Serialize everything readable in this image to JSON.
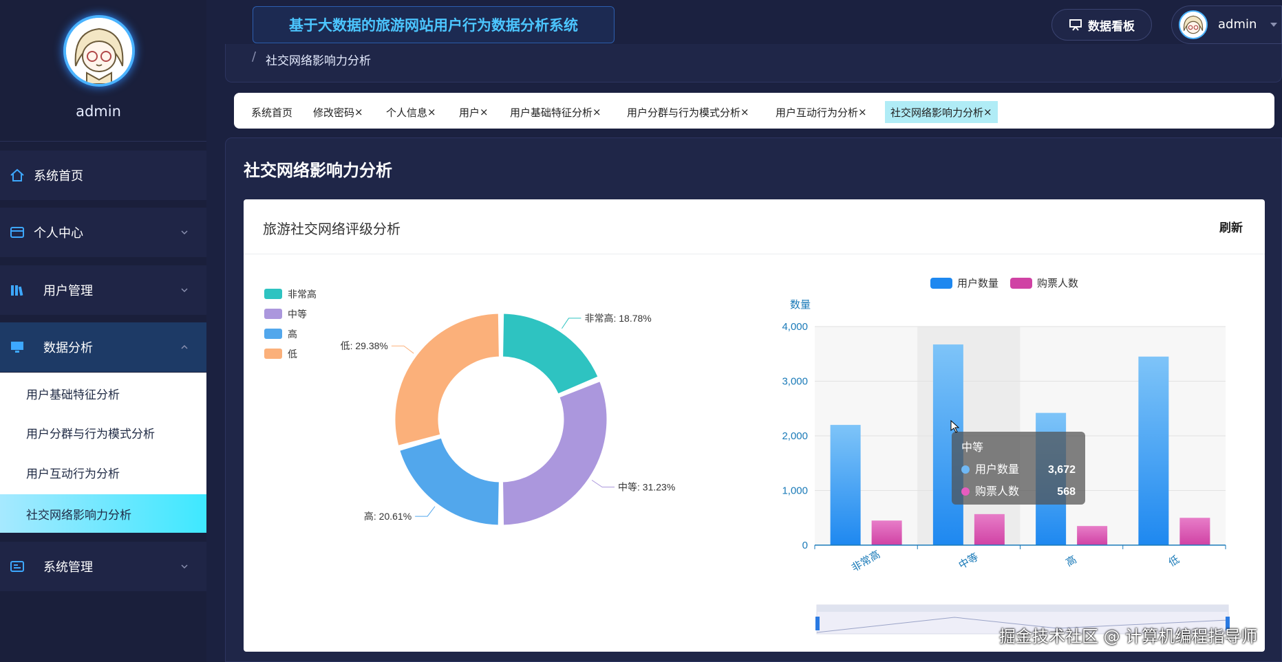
{
  "sidebar": {
    "username": "admin",
    "menu": [
      {
        "label": "系统首页"
      },
      {
        "label": "个人中心"
      },
      {
        "label": "用户管理"
      },
      {
        "label": "数据分析"
      },
      {
        "label": "系统管理"
      }
    ],
    "submenu": [
      {
        "label": "用户基础特征分析"
      },
      {
        "label": "用户分群与行为模式分析"
      },
      {
        "label": "用户互动行为分析"
      },
      {
        "label": "社交网络影响力分析"
      }
    ]
  },
  "header": {
    "title": "基于大数据的旅游网站用户行为数据分析系统",
    "dashboard_label": "数据看板",
    "username": "admin"
  },
  "breadcrumb": {
    "separator": "/",
    "current": "社交网络影响力分析"
  },
  "tabs": [
    {
      "label": "系统首页"
    },
    {
      "label": "修改密码",
      "close": "×"
    },
    {
      "label": "个人信息",
      "close": "×"
    },
    {
      "label": "用户",
      "close": "×"
    },
    {
      "label": "用户基础特征分析",
      "close": "×"
    },
    {
      "label": "用户分群与行为模式分析",
      "close": "×"
    },
    {
      "label": "用户互动行为分析",
      "close": "×"
    },
    {
      "label": "社交网络影响力分析",
      "close": "×"
    }
  ],
  "page": {
    "title": "社交网络影响力分析"
  },
  "card": {
    "title": "旅游社交网络评级分析",
    "refresh_label": "刷新"
  },
  "chart_data": [
    {
      "type": "pie",
      "variant": "donut",
      "legend": [
        "非常高",
        "中等",
        "高",
        "低"
      ],
      "legend_placement": "top-left",
      "slices": [
        {
          "label": "非常高",
          "value": 18.78,
          "display": "非常高: 18.78%",
          "color": "#2ec3c1"
        },
        {
          "label": "中等",
          "value": 31.23,
          "display": "中等: 31.23%",
          "color": "#ab97dd"
        },
        {
          "label": "高",
          "value": 20.61,
          "display": "高: 20.61%",
          "color": "#52a7ec"
        },
        {
          "label": "低",
          "value": 29.38,
          "display": "低: 29.38%",
          "color": "#fbb07a"
        }
      ]
    },
    {
      "type": "bar",
      "categories": [
        "非常高",
        "中等",
        "高",
        "低"
      ],
      "series": [
        {
          "name": "用户数量",
          "values": [
            2200,
            3672,
            2420,
            3450
          ],
          "color": "#1e88f0"
        },
        {
          "name": "购票人数",
          "values": [
            450,
            568,
            350,
            500
          ],
          "color": "#d042a4"
        }
      ],
      "ylabel": "数量",
      "ylim": [
        0,
        4000
      ],
      "yticks": [
        0,
        1000,
        2000,
        3000,
        4000
      ],
      "ytick_labels": [
        "0",
        "1,000",
        "2,000",
        "3,000",
        "4,000"
      ],
      "legend_placement": "top-center",
      "grid": true,
      "highlighted_category": "中等",
      "tooltip": {
        "title": "中等",
        "rows": [
          {
            "name": "用户数量",
            "value": "3,672"
          },
          {
            "name": "购票人数",
            "value": "568"
          }
        ]
      }
    }
  ],
  "watermark": "掘金技术社区 @ 计算机编程指导师"
}
